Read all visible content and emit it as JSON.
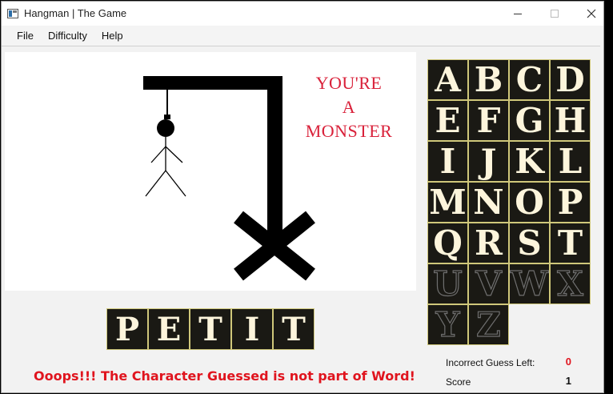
{
  "window": {
    "title": "Hangman | The Game",
    "icons": {
      "app": "app-window-icon",
      "minimize": "minimize-icon",
      "maximize": "maximize-icon",
      "close": "close-icon"
    }
  },
  "menu": {
    "items": [
      {
        "label": "File"
      },
      {
        "label": "Difficulty"
      },
      {
        "label": "Help"
      }
    ]
  },
  "verdict": {
    "lines": [
      "YOU'RE",
      "A",
      "MONSTER"
    ],
    "color": "#d9213a"
  },
  "word": {
    "letters": [
      "P",
      "E",
      "T",
      "I",
      "T"
    ]
  },
  "keyboard": {
    "keys": [
      {
        "letter": "A",
        "state": "available"
      },
      {
        "letter": "B",
        "state": "available"
      },
      {
        "letter": "C",
        "state": "available"
      },
      {
        "letter": "D",
        "state": "available"
      },
      {
        "letter": "E",
        "state": "available"
      },
      {
        "letter": "F",
        "state": "available"
      },
      {
        "letter": "G",
        "state": "available"
      },
      {
        "letter": "H",
        "state": "available"
      },
      {
        "letter": "I",
        "state": "available"
      },
      {
        "letter": "J",
        "state": "available"
      },
      {
        "letter": "K",
        "state": "available"
      },
      {
        "letter": "L",
        "state": "available"
      },
      {
        "letter": "M",
        "state": "available"
      },
      {
        "letter": "N",
        "state": "available"
      },
      {
        "letter": "O",
        "state": "available"
      },
      {
        "letter": "P",
        "state": "available"
      },
      {
        "letter": "Q",
        "state": "available"
      },
      {
        "letter": "R",
        "state": "available"
      },
      {
        "letter": "S",
        "state": "available"
      },
      {
        "letter": "T",
        "state": "available"
      },
      {
        "letter": "U",
        "state": "used"
      },
      {
        "letter": "V",
        "state": "used"
      },
      {
        "letter": "W",
        "state": "used"
      },
      {
        "letter": "X",
        "state": "used"
      },
      {
        "letter": "Y",
        "state": "used"
      },
      {
        "letter": "Z",
        "state": "used"
      }
    ]
  },
  "status": {
    "message": "Ooops!!! The Character Guessed is not part of Word!",
    "incorrect_label": "Incorrect  Guess Left:",
    "incorrect_value": "0",
    "score_label": "Score",
    "score_value": "1",
    "message_color": "#e0141e",
    "incorrect_value_color": "#e0141e",
    "score_value_color": "#111111"
  }
}
